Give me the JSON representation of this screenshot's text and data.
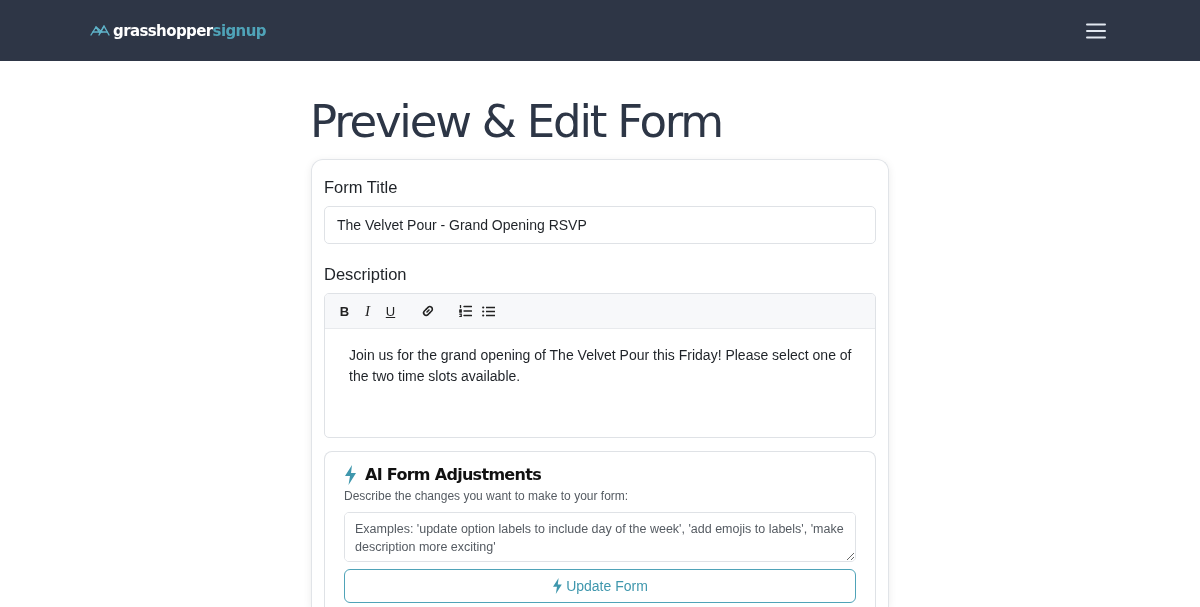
{
  "header": {
    "logo": {
      "text": "grasshopper",
      "accent": "signup"
    }
  },
  "page": {
    "title": "Preview & Edit Form"
  },
  "form": {
    "title_field": {
      "label": "Form Title",
      "value": "The Velvet Pour - Grand Opening RSVP"
    },
    "description_field": {
      "label": "Description",
      "toolbar": [
        {
          "items": [
            {
              "kind": "bold",
              "label": "B"
            },
            {
              "kind": "italic",
              "label": "I"
            },
            {
              "kind": "underline",
              "label": "U"
            }
          ]
        },
        {
          "items": [
            {
              "kind": "link"
            }
          ]
        },
        {
          "items": [
            {
              "kind": "ordered-list"
            },
            {
              "kind": "bullet-list"
            }
          ]
        }
      ],
      "value": "Join us for the grand opening of The Velvet Pour this Friday! Please select one of the two time slots available."
    },
    "ai_panel": {
      "title": "AI Form Adjustments",
      "prompt": "Describe the changes you want to make to your form:",
      "input": {
        "placeholder": "Examples: 'update option labels to include day of the week', 'add emojis to labels', 'make description more exciting'"
      },
      "button": {
        "label": "Update Form"
      }
    }
  }
}
